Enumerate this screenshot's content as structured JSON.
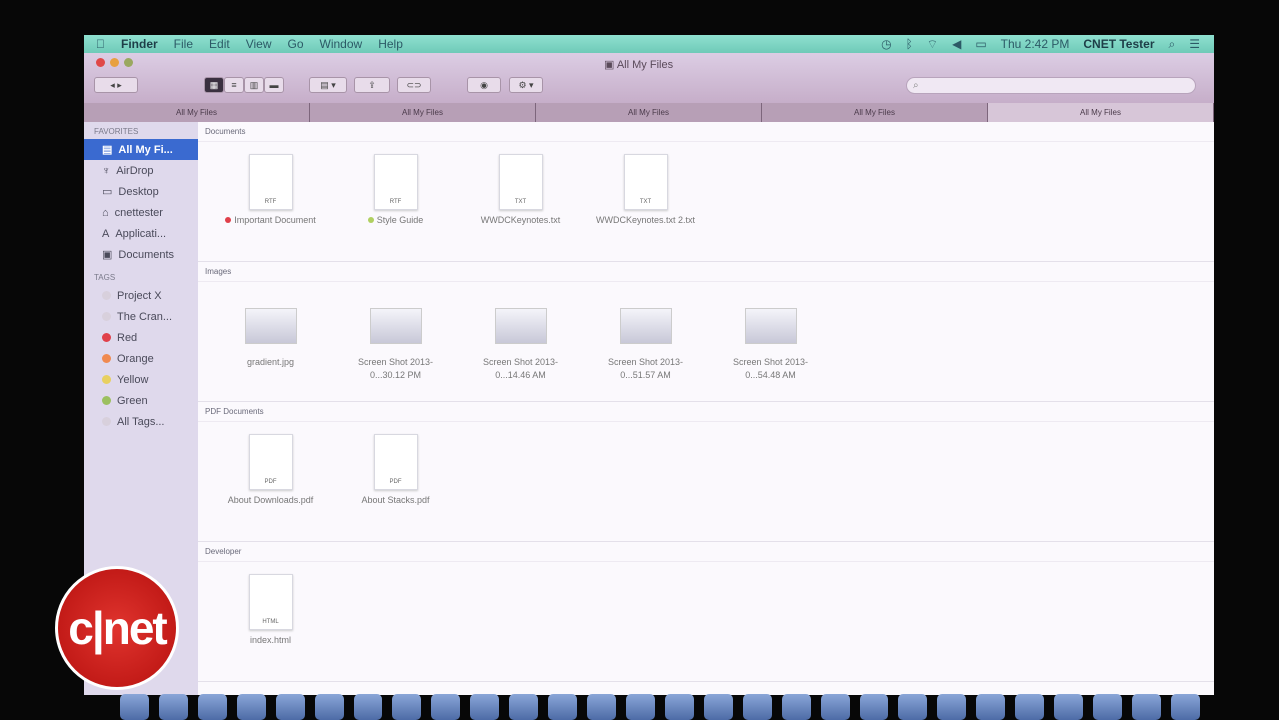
{
  "menubar": {
    "apple": "",
    "app": "Finder",
    "items": [
      "File",
      "Edit",
      "View",
      "Go",
      "Window",
      "Help"
    ],
    "clock": "Thu 2:42 PM",
    "user": "CNET Tester"
  },
  "window": {
    "title": "All My Files",
    "search_placeholder": "",
    "tabs": [
      "All My Files",
      "All My Files",
      "All My Files",
      "All My Files",
      "All My Files"
    ]
  },
  "sidebar": {
    "favorites_header": "FAVORITES",
    "favorites": [
      "All My Fi...",
      "AirDrop",
      "Desktop",
      "cnettester",
      "Applicati...",
      "Documents"
    ],
    "tags_header": "TAGS",
    "tags": [
      {
        "label": "Project X",
        "color": "#d8d0dc"
      },
      {
        "label": "The Cran...",
        "color": "#d8d0dc"
      },
      {
        "label": "Red",
        "color": "#e0404a"
      },
      {
        "label": "Orange",
        "color": "#f08a50"
      },
      {
        "label": "Yellow",
        "color": "#e8d060"
      },
      {
        "label": "Green",
        "color": "#9cc060"
      },
      {
        "label": "All Tags...",
        "color": "#d8d0dc"
      }
    ]
  },
  "sections": [
    {
      "title": "Documents",
      "kind": "file",
      "items": [
        {
          "name": "Important Document",
          "ext": "RTF",
          "tag": "#e0404a"
        },
        {
          "name": "Style Guide",
          "ext": "RTF",
          "tag": "#b0d060"
        },
        {
          "name": "WWDCKeynotes.txt",
          "ext": "TXT"
        },
        {
          "name": "WWDCKeynotes.txt 2.txt",
          "ext": "TXT"
        }
      ]
    },
    {
      "title": "Images",
      "kind": "image",
      "items": [
        {
          "name": "gradient.jpg"
        },
        {
          "name": "Screen Shot 2013-0...30.12 PM"
        },
        {
          "name": "Screen Shot 2013-0...14.46 AM"
        },
        {
          "name": "Screen Shot 2013-0...51.57 AM"
        },
        {
          "name": "Screen Shot 2013-0...54.48 AM"
        }
      ]
    },
    {
      "title": "PDF Documents",
      "kind": "file",
      "items": [
        {
          "name": "About Downloads.pdf",
          "ext": "PDF"
        },
        {
          "name": "About Stacks.pdf",
          "ext": "PDF"
        }
      ]
    },
    {
      "title": "Developer",
      "kind": "file",
      "items": [
        {
          "name": "index.html",
          "ext": "HTML"
        }
      ]
    }
  ],
  "logo": "c|net"
}
